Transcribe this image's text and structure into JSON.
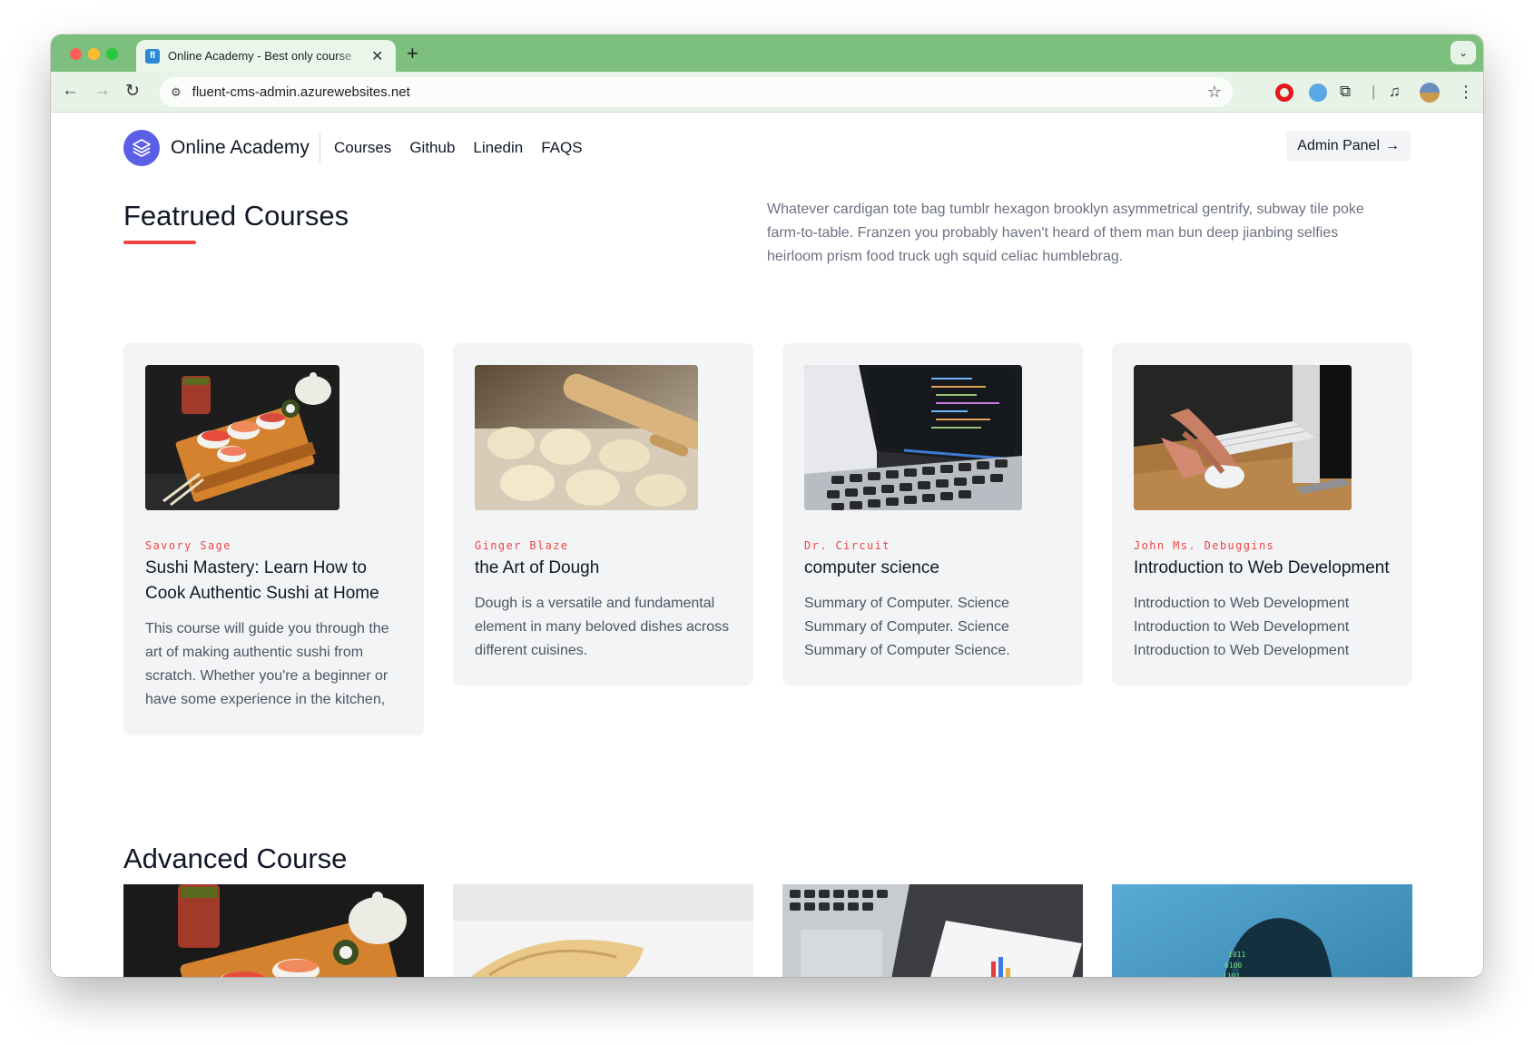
{
  "browser": {
    "tab_title": "Online Academy - Best only course",
    "tab_favicon": "fl",
    "new_tab": "+",
    "url": "fluent-cms-admin.azurewebsites.net"
  },
  "header": {
    "brand": "Online Academy",
    "nav": [
      "Courses",
      "Github",
      "Linedin",
      "FAQS"
    ],
    "admin_button": "Admin Panel",
    "admin_arrow": "→"
  },
  "featured": {
    "title": "Featrued Courses",
    "description": "Whatever cardigan tote bag tumblr hexagon brooklyn asymmetrical gentrify, subway tile poke farm-to-table. Franzen you probably haven't heard of them man bun deep jianbing selfies heirloom prism food truck ugh squid celiac humblebrag.",
    "cards": [
      {
        "author": "Savory Sage",
        "title": "Sushi Mastery: Learn How to Cook Authentic Sushi at Home",
        "description": "This course will guide you through the art of making authentic sushi from scratch. Whether you're a beginner or have some experience in the kitchen,",
        "image": "sushi-image"
      },
      {
        "author": "Ginger Blaze",
        "title": "the Art of Dough",
        "description": "Dough is a versatile and fundamental element in many beloved dishes across different cuisines.",
        "image": "dough-image"
      },
      {
        "author": "Dr. Circuit",
        "title": "computer science",
        "description": "Summary of Computer. Science Summary of Computer. Science Summary of Computer Science.",
        "image": "laptop-code-image"
      },
      {
        "author": "John Ms. Debuggins",
        "title": "Introduction to Web Development",
        "description": "Introduction to Web Development Introduction to Web Development Introduction to Web Development",
        "image": "mouse-desk-image"
      }
    ]
  },
  "advanced": {
    "title": "Advanced Course",
    "images": [
      "sushi-image",
      "food-plate-image",
      "laptop-charts-image",
      "face-code-image"
    ]
  },
  "colors": {
    "accent": "#ef4444",
    "brand": "#5b5fe8",
    "chrome": "#7dbf7d",
    "card_bg": "#f3f4f6"
  },
  "icons": {
    "back": "arrow-left-icon",
    "forward": "arrow-right-icon",
    "reload": "reload-icon",
    "bookmark": "star-icon",
    "menu": "kebab-menu-icon"
  }
}
